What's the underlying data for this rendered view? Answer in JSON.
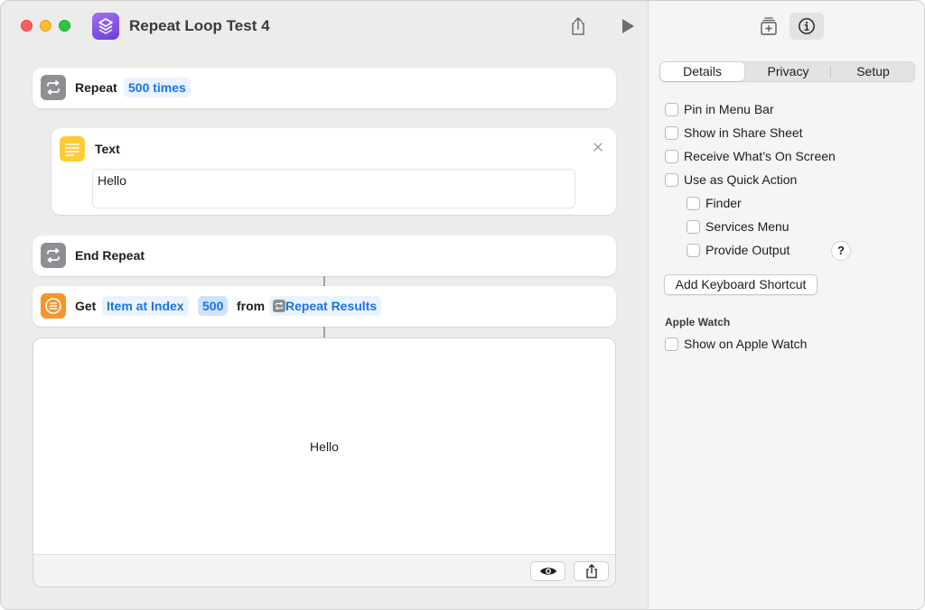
{
  "window": {
    "title": "Repeat Loop Test 4"
  },
  "repeat": {
    "label": "Repeat",
    "count_token": "500 times"
  },
  "text_action": {
    "label": "Text",
    "value": "Hello"
  },
  "end_repeat": {
    "label": "End Repeat"
  },
  "get_action": {
    "label": "Get",
    "item_token": "Item at Index",
    "index_token": "500",
    "from_label": "from",
    "source_token": "Repeat Results"
  },
  "result": {
    "text": "Hello"
  },
  "inspector": {
    "tabs": [
      "Details",
      "Privacy",
      "Setup"
    ],
    "active_tab": "Details",
    "options": [
      {
        "label": "Pin in Menu Bar",
        "checked": false
      },
      {
        "label": "Show in Share Sheet",
        "checked": false
      },
      {
        "label": "Receive What’s On Screen",
        "checked": false
      },
      {
        "label": "Use as Quick Action",
        "checked": false
      }
    ],
    "sub_options": [
      {
        "label": "Finder",
        "checked": false
      },
      {
        "label": "Services Menu",
        "checked": false
      },
      {
        "label": "Provide Output",
        "checked": false
      }
    ],
    "help_glyph": "?",
    "keyboard_shortcut_button": "Add Keyboard Shortcut",
    "apple_watch_heading": "Apple Watch",
    "apple_watch_option": {
      "label": "Show on Apple Watch",
      "checked": false
    }
  },
  "colors": {
    "accent_blue": "#1a73e8",
    "repeat_icon": "#8e8e93",
    "text_icon": "#ffcc33",
    "get_icon": "#f7952b",
    "app_icon": "#7b4fe0"
  },
  "icons": {
    "app": "shortcuts-app-icon",
    "share": "share-icon",
    "run": "play-icon",
    "repeat": "repeat-icon",
    "text": "text-lines-icon",
    "get": "list-icon",
    "close": "close-icon",
    "preview": "eye-icon",
    "result_share": "share-icon",
    "add_to_library": "add-library-icon",
    "info": "info-icon"
  }
}
